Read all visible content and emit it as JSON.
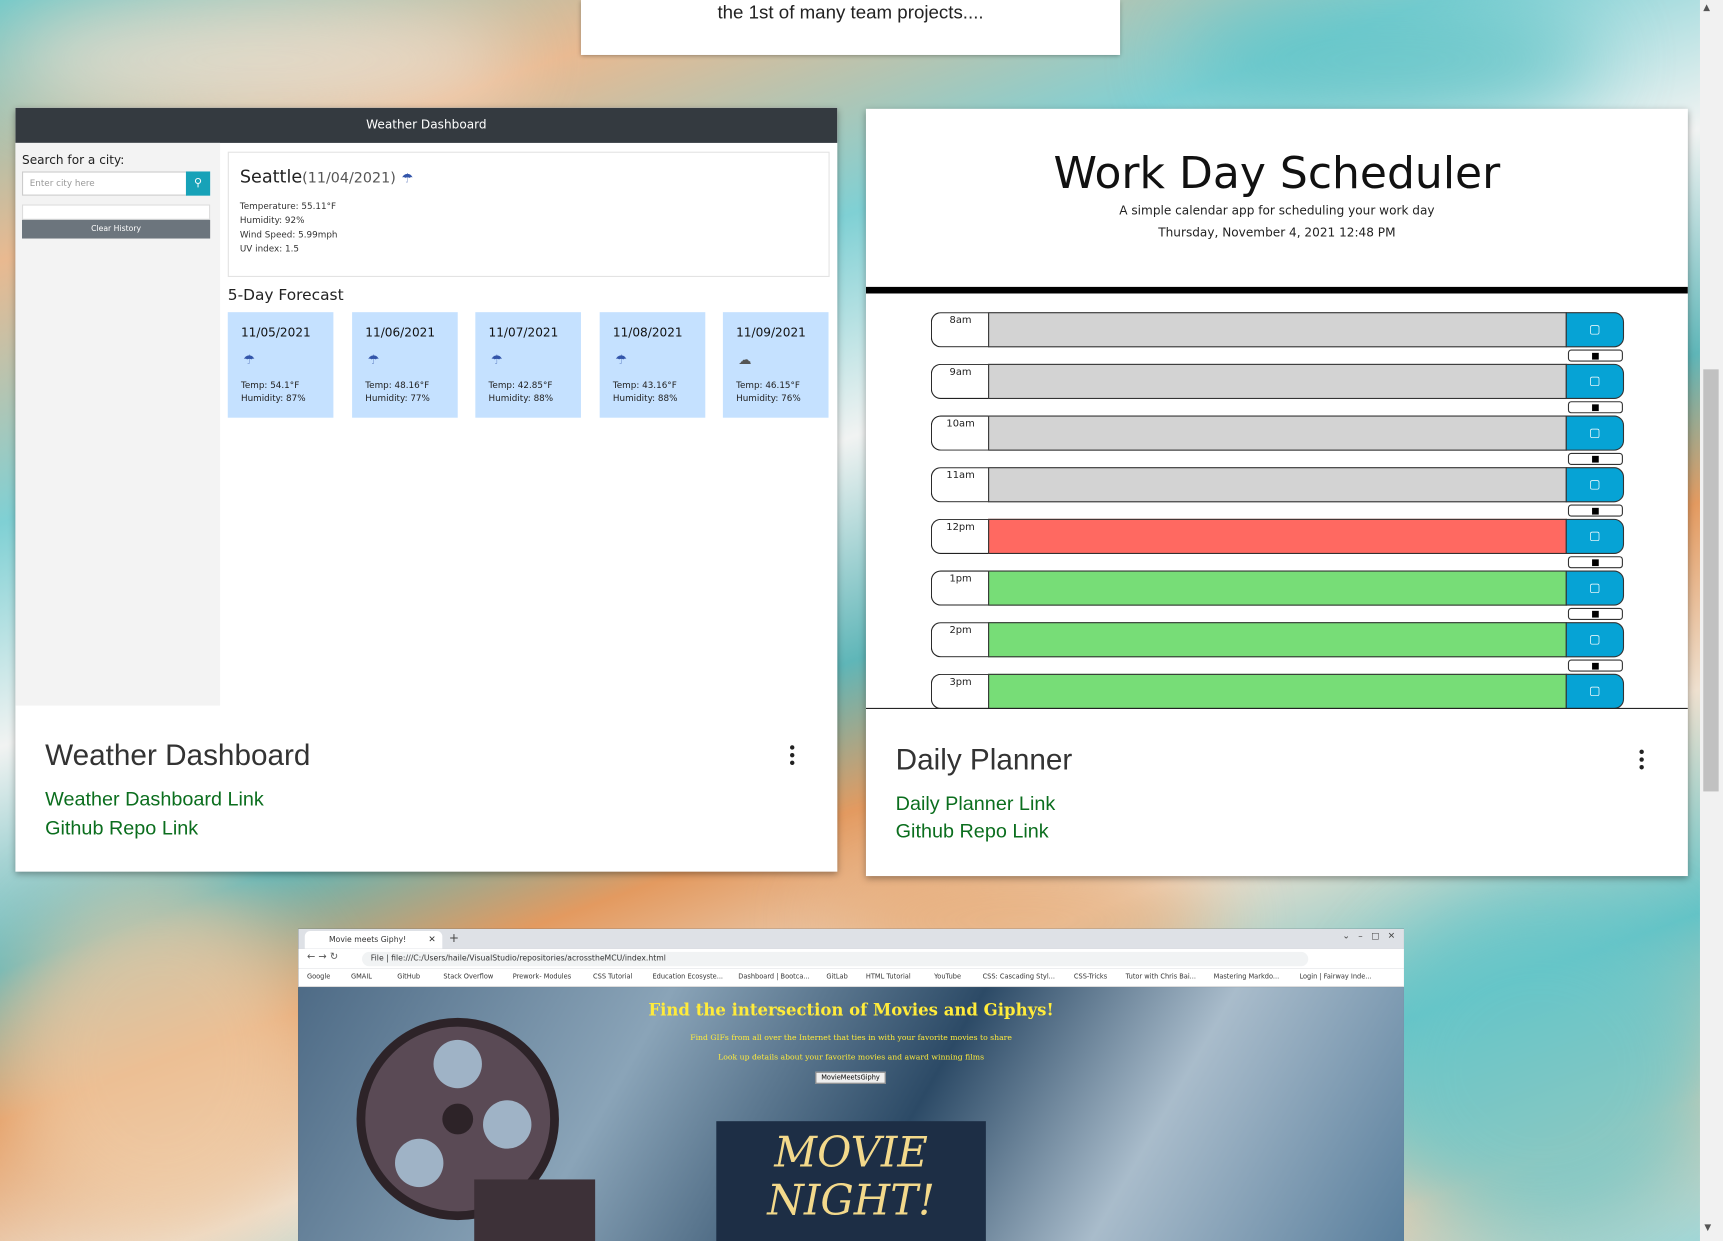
{
  "intro": {
    "text": "the 1st of many team projects...."
  },
  "weather_card": {
    "preview": {
      "navbar_title": "Weather Dashboard",
      "search_label": "Search for a city:",
      "search_placeholder": "Enter city here",
      "clear_label": "Clear History",
      "city": "Seattle",
      "date": "(11/04/2021)",
      "temperature": "Temperature: 55.11°F",
      "humidity": "Humidity: 92%",
      "wind": "Wind Speed: 5.99mph",
      "uv": "UV index: 1.5",
      "forecast_heading": "5-Day Forecast",
      "forecast": [
        {
          "date": "11/05/2021",
          "temp": "Temp: 54.1°F",
          "humidity": "Humidity: 87%",
          "icon": "rain-icon"
        },
        {
          "date": "11/06/2021",
          "temp": "Temp: 48.16°F",
          "humidity": "Humidity: 77%",
          "icon": "rain-icon"
        },
        {
          "date": "11/07/2021",
          "temp": "Temp: 42.85°F",
          "humidity": "Humidity: 88%",
          "icon": "rain-icon"
        },
        {
          "date": "11/08/2021",
          "temp": "Temp: 43.16°F",
          "humidity": "Humidity: 88%",
          "icon": "rain-icon"
        },
        {
          "date": "11/09/2021",
          "temp": "Temp: 46.15°F",
          "humidity": "Humidity: 76%",
          "icon": "cloud-icon"
        }
      ]
    },
    "title": "Weather Dashboard",
    "link1": "Weather Dashboard Link",
    "link2": "Github Repo Link"
  },
  "planner_card": {
    "preview": {
      "heading": "Work Day Scheduler",
      "subtitle": "A simple calendar app for scheduling your work day",
      "datetime": "Thursday, November 4, 2021 12:48 PM",
      "rows": [
        {
          "hour": "8am",
          "state": "past"
        },
        {
          "hour": "9am",
          "state": "past"
        },
        {
          "hour": "10am",
          "state": "past"
        },
        {
          "hour": "11am",
          "state": "past"
        },
        {
          "hour": "12pm",
          "state": "present"
        },
        {
          "hour": "1pm",
          "state": "future"
        },
        {
          "hour": "2pm",
          "state": "future"
        },
        {
          "hour": "3pm",
          "state": "future"
        }
      ]
    },
    "title": "Daily Planner",
    "link1": "Daily Planner Link",
    "link2": "Github Repo Link"
  },
  "colors": {
    "past": "#d3d3d3",
    "present": "#ff6961",
    "future": "#77dd77",
    "save": "#06a3d5",
    "link": "#0b6e1e"
  },
  "movie_preview": {
    "tab_title": "Movie meets Giphy!",
    "url": "File | file:///C:/Users/haile/VisualStudio/repositories/acrosstheMCU/index.html",
    "bookmarks": [
      "Google",
      "GMAIL",
      "GitHub",
      "Stack Overflow",
      "Prework- Modules",
      "CSS Tutorial",
      "Education Ecosyste...",
      "Dashboard | Bootca...",
      "GitLab",
      "HTML Tutorial",
      "YouTube",
      "CSS: Cascading Styl...",
      "CSS-Tricks",
      "Tutor with Chris Bai...",
      "Mastering Markdo...",
      "Login | Fairway Inde..."
    ],
    "heading": "Find the intersection of Movies and Giphys!",
    "line1": "Find GIFs from all over the Internet that ties in with your favorite movies to share",
    "line2": "Look up details about your favorite movies and award winning films",
    "button": "MovieMeetsGiphy",
    "poster": "MOVIE NIGHT!"
  }
}
